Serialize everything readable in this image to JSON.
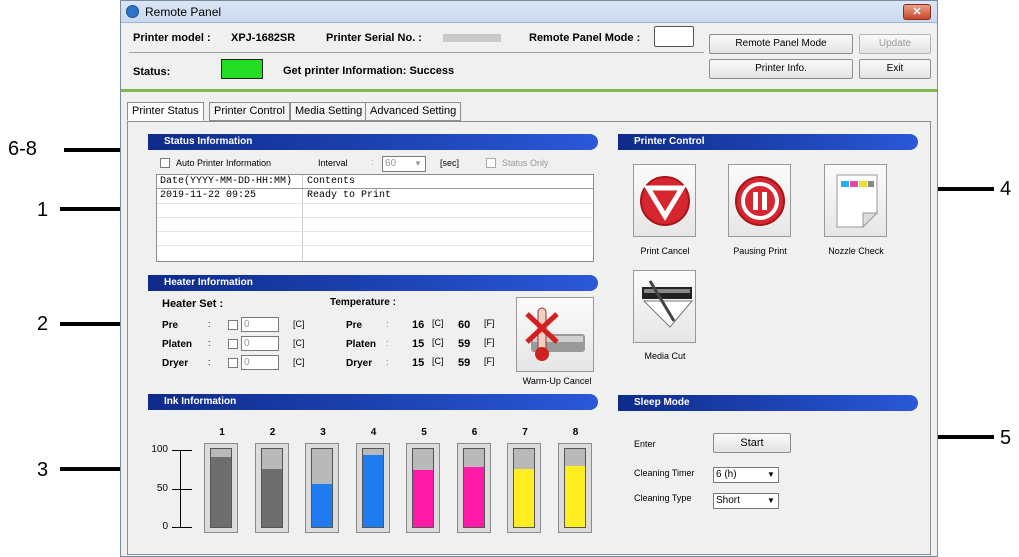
{
  "window": {
    "title": "Remote Panel"
  },
  "header": {
    "printer_model_label": "Printer model :",
    "printer_model_value": "XPJ-1682SR",
    "serial_label": "Printer Serial No. :",
    "remote_mode_label": "Remote Panel Mode :",
    "status_label": "Status:",
    "status_message": "Get printer Information: Success",
    "status_color": "#22dd22"
  },
  "toolbar": {
    "remote_panel_mode": "Remote Panel Mode",
    "update": "Update",
    "printer_info": "Printer Info.",
    "exit": "Exit"
  },
  "tabs": [
    "Printer Status",
    "Printer Control",
    "Media Setting",
    "Advanced Setting"
  ],
  "status_info": {
    "title": "Status Information",
    "auto_label": "Auto Printer Information",
    "interval_label": "Interval",
    "interval_value": "60",
    "unit": "[sec]",
    "status_only": "Status Only",
    "columns": [
      "Date(YYYY-MM-DD-HH:MM)",
      "Contents"
    ],
    "rows": [
      [
        "2019-11-22 09:25",
        "Ready to Print"
      ]
    ]
  },
  "heater": {
    "title": "Heater Information",
    "set_label": "Heater Set :",
    "temp_label": "Temperature :",
    "rows": [
      {
        "name": "Pre",
        "set": "0",
        "unit": "[C]",
        "temp_c": "16",
        "c": "[C]",
        "temp_f": "60",
        "f": "[F]"
      },
      {
        "name": "Platen",
        "set": "0",
        "unit": "[C]",
        "temp_c": "15",
        "c": "[C]",
        "temp_f": "59",
        "f": "[F]"
      },
      {
        "name": "Dryer",
        "set": "0",
        "unit": "[C]",
        "temp_c": "15",
        "c": "[C]",
        "temp_f": "59",
        "f": "[F]"
      }
    ],
    "warmup_cancel": "Warm-Up Cancel"
  },
  "ink": {
    "title": "Ink Information",
    "y_ticks": [
      "100",
      "50",
      "0"
    ],
    "channels": [
      {
        "label": "1",
        "level": 0.9,
        "color": "#6e6e6e"
      },
      {
        "label": "2",
        "level": 0.75,
        "color": "#6e6e6e"
      },
      {
        "label": "3",
        "level": 0.55,
        "color": "#1e7cf0"
      },
      {
        "label": "4",
        "level": 0.92,
        "color": "#1e7cf0"
      },
      {
        "label": "5",
        "level": 0.73,
        "color": "#ff1aa8"
      },
      {
        "label": "6",
        "level": 0.77,
        "color": "#ff1aa8"
      },
      {
        "label": "7",
        "level": 0.74,
        "color": "#ffee22"
      },
      {
        "label": "8",
        "level": 0.78,
        "color": "#ffee22"
      }
    ]
  },
  "printer_control": {
    "title": "Printer Control",
    "print_cancel": "Print Cancel",
    "pausing_print": "Pausing Print",
    "nozzle_check": "Nozzle Check",
    "media_cut": "Media Cut"
  },
  "sleep": {
    "title": "Sleep Mode",
    "enter_label": "Enter",
    "start": "Start",
    "cleaning_timer_label": "Cleaning Timer",
    "cleaning_timer_value": "6 (h)",
    "cleaning_type_label": "Cleaning Type",
    "cleaning_type_value": "Short"
  },
  "callouts": [
    "6-8",
    "1",
    "2",
    "3",
    "4",
    "5"
  ]
}
